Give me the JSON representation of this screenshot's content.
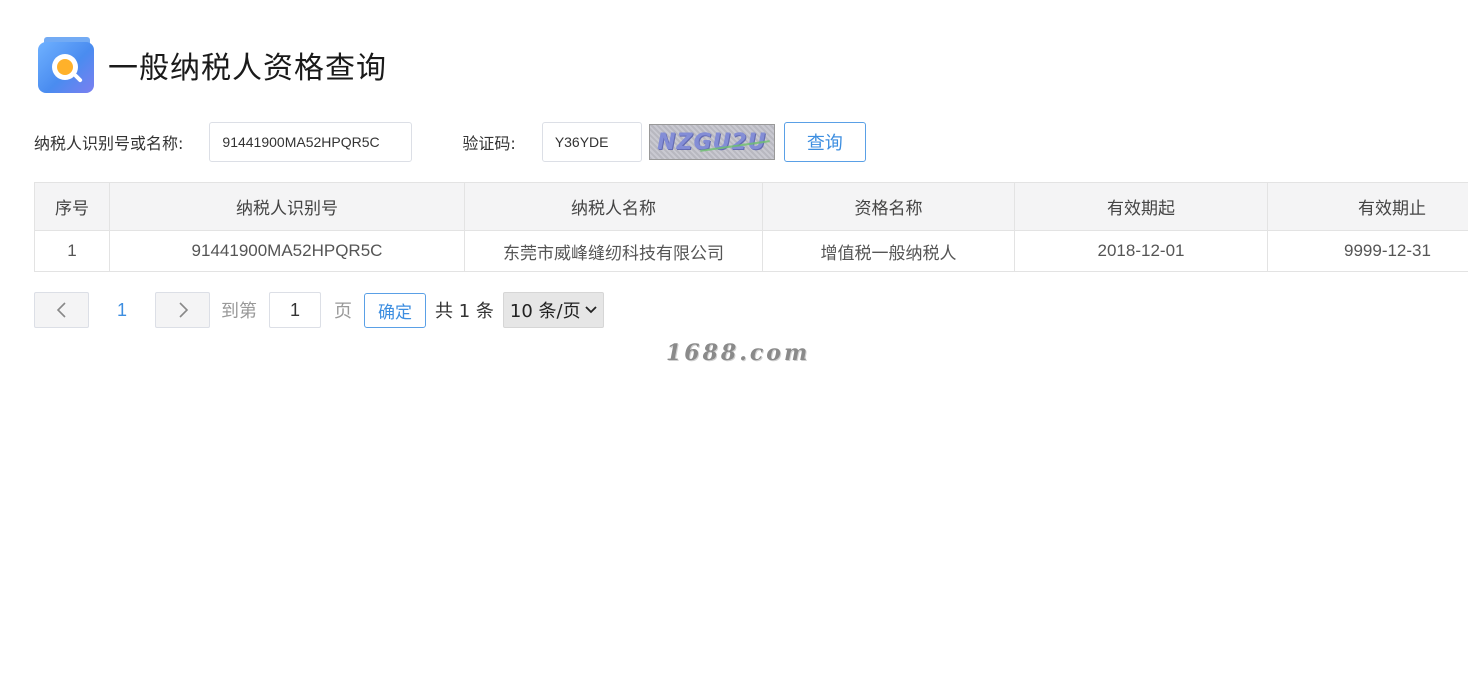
{
  "header": {
    "title": "一般纳税人资格查询",
    "logo_icon": "document-search-icon"
  },
  "form": {
    "tax_label": "纳税人识别号或名称:",
    "tax_value": "91441900MA52HPQR5C",
    "captcha_label": "验证码:",
    "captcha_value": "Y36YDE",
    "captcha_image_text": "NZGU2U",
    "query_label": "查询"
  },
  "table": {
    "columns": [
      "序号",
      "纳税人识别号",
      "纳税人名称",
      "资格名称",
      "有效期起",
      "有效期止"
    ],
    "rows": [
      [
        "1",
        "91441900MA52HPQR5C",
        "东莞市威峰缝纫科技有限公司",
        "增值税一般纳税人",
        "2018-12-01",
        "9999-12-31"
      ]
    ]
  },
  "pagination": {
    "prev_icon": "chevron-left-icon",
    "next_icon": "chevron-right-icon",
    "current_page": "1",
    "goto_label": "到第",
    "goto_value": "1",
    "page_unit": "页",
    "confirm_label": "确定",
    "total_text": "共 1 条",
    "page_size": "10 条/页"
  },
  "watermark": {
    "text": "1688.com"
  },
  "colors": {
    "accent": "#3d8ee0",
    "header_bg": "#f4f4f5",
    "border": "#e3e3e3"
  }
}
